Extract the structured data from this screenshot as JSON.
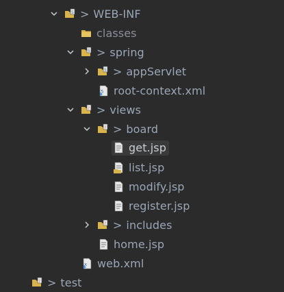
{
  "tree": {
    "web_inf": {
      "label": "WEB-INF",
      "prefix": ">",
      "icon": "folder-source-icon"
    },
    "classes": {
      "label": "classes",
      "icon": "folder-icon"
    },
    "spring": {
      "label": "spring",
      "prefix": ">",
      "icon": "folder-source-icon"
    },
    "appservlet": {
      "label": "appServlet",
      "prefix": ">",
      "icon": "folder-source-icon"
    },
    "root_context": {
      "label": "root-context.xml",
      "icon": "xml-file-icon"
    },
    "views": {
      "label": "views",
      "prefix": ">",
      "icon": "folder-source-icon"
    },
    "board": {
      "label": "board",
      "prefix": ">",
      "icon": "folder-source-icon"
    },
    "get_jsp": {
      "label": "get.jsp",
      "icon": "jsp-file-icon"
    },
    "list_jsp": {
      "label": "list.jsp",
      "icon": "jsp-file-icon"
    },
    "modify_jsp": {
      "label": "modify.jsp",
      "icon": "jsp-file-icon"
    },
    "register_jsp": {
      "label": "register.jsp",
      "icon": "jsp-file-icon"
    },
    "includes": {
      "label": "includes",
      "prefix": ">",
      "icon": "folder-source-icon"
    },
    "home_jsp": {
      "label": "home.jsp",
      "icon": "jsp-file-icon"
    },
    "web_xml": {
      "label": "web.xml",
      "icon": "xml-file-icon"
    },
    "test": {
      "label": "test",
      "prefix": ">",
      "icon": "folder-source-icon"
    }
  },
  "colors": {
    "background": "#2b2b2b",
    "text": "#9aa7b8",
    "selection": "#3a3a3a",
    "folder": "#d9b44a"
  }
}
